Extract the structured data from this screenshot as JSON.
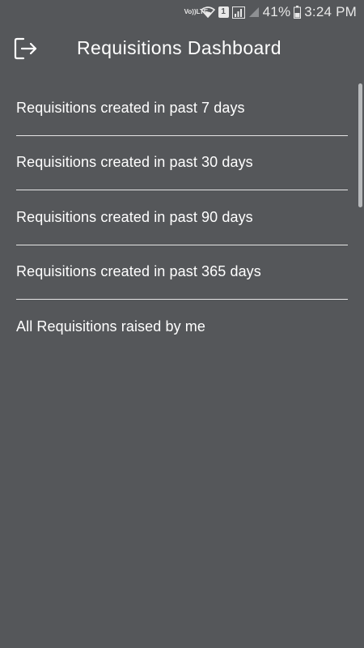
{
  "status_bar": {
    "volte_line1": "Vo))",
    "volte_line2": "LTE",
    "sim_number": "1",
    "battery_percent": "41%",
    "time": "3:24 PM"
  },
  "header": {
    "title": "Requisitions Dashboard",
    "back_icon": "logout-arrow-icon"
  },
  "list": {
    "items": [
      {
        "label": "Requisitions created in past 7 days"
      },
      {
        "label": "Requisitions created in past 30 days"
      },
      {
        "label": "Requisitions created in past 90 days"
      },
      {
        "label": "Requisitions created in past 365 days"
      },
      {
        "label": "All Requisitions raised by me"
      }
    ]
  },
  "colors": {
    "background": "#55575a",
    "text": "#ffffff",
    "divider": "#e6e6e6",
    "scrollbar": "#b8babc"
  }
}
